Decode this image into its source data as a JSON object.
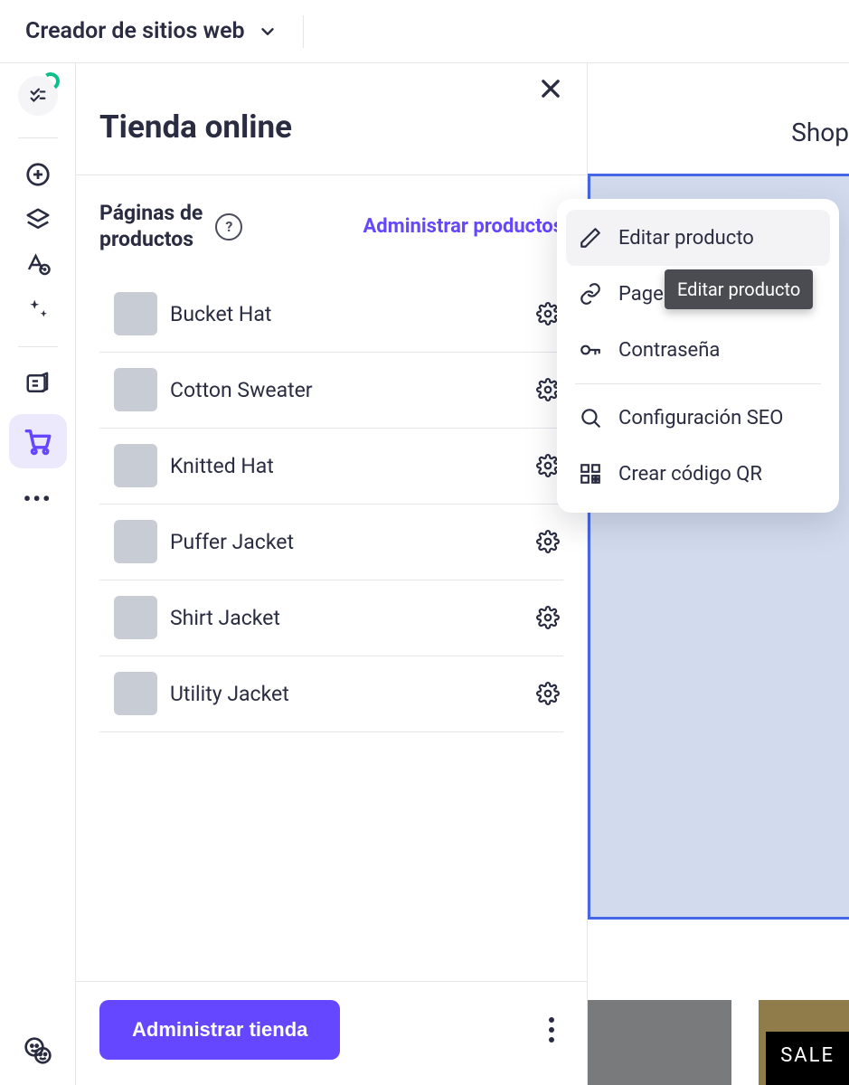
{
  "topbar": {
    "title": "Creador de sitios web"
  },
  "panel": {
    "heading": "Tienda online",
    "section_title_line1": "Páginas de",
    "section_title_line2": "productos",
    "manage_products": "Administrar productos",
    "products": [
      {
        "name": "Bucket Hat"
      },
      {
        "name": "Cotton Sweater"
      },
      {
        "name": "Knitted Hat"
      },
      {
        "name": "Puffer Jacket"
      },
      {
        "name": "Shirt Jacket"
      },
      {
        "name": "Utility Jacket"
      }
    ],
    "footer_button": "Administrar tienda"
  },
  "canvas": {
    "shop_label": "Shop",
    "sale_badge": "SALE"
  },
  "context_menu": {
    "edit": "Editar producto",
    "page": "Page",
    "password": "Contraseña",
    "seo": "Configuración SEO",
    "qr": "Crear código QR"
  },
  "tooltip": "Editar producto"
}
